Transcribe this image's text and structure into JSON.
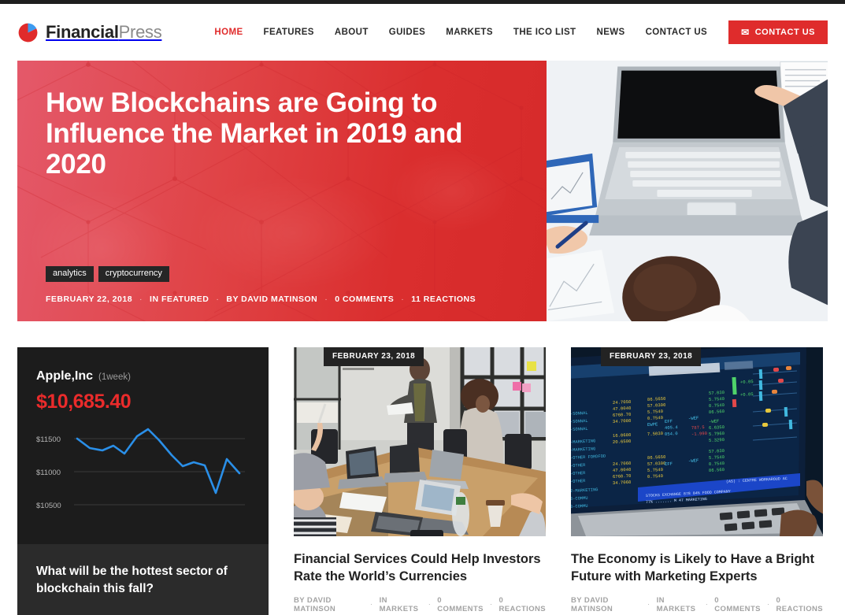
{
  "brand": {
    "name_bold": "Financial",
    "name_light": "Press",
    "logo_icon": "pie-chart-icon",
    "accent_red": "#df2c2c",
    "accent_blue": "#2a8fe8"
  },
  "nav": {
    "items": [
      {
        "label": "HOME",
        "active": true
      },
      {
        "label": "FEATURES",
        "active": false
      },
      {
        "label": "ABOUT",
        "active": false
      },
      {
        "label": "GUIDES",
        "active": false
      },
      {
        "label": "MARKETS",
        "active": false
      },
      {
        "label": "THE ICO LIST",
        "active": false
      },
      {
        "label": "NEWS",
        "active": false
      },
      {
        "label": "CONTACT US",
        "active": false
      }
    ],
    "cta": {
      "label": "CONTACT US",
      "icon": "envelope-icon"
    }
  },
  "hero": {
    "title": "How Blockchains are Going to Influence the Market in 2019 and 2020",
    "tags": [
      "analytics",
      "cryptocurrency"
    ],
    "meta": {
      "date": "FEBRUARY 22, 2018",
      "category": "IN FEATURED",
      "author": "BY DAVID MATINSON",
      "comments": "0 COMMENTS",
      "reactions": "11 REACTIONS",
      "separator": "·"
    },
    "image_alt": "businessman-pointing-at-laptop-on-white-desk"
  },
  "stock_widget": {
    "name": "Apple,Inc",
    "period": "(1week)",
    "price": "$10,685.40"
  },
  "chart_data": {
    "type": "line",
    "title": "Apple,Inc (1week)",
    "xlabel": "",
    "ylabel": "",
    "ylim": [
      10350,
      11750
    ],
    "ytick_labels": [
      "$11500",
      "$11000",
      "$10500"
    ],
    "ytick_values": [
      11500,
      11000,
      10500
    ],
    "grid": true,
    "legend": "none",
    "line_color": "#2a8fe8",
    "series": [
      {
        "name": "Apple,Inc",
        "x": [
          0,
          1,
          2,
          3,
          4,
          5,
          6,
          7,
          8,
          9,
          10,
          11,
          12,
          13,
          14,
          15
        ],
        "values": [
          11500,
          11360,
          11400,
          11290,
          11520,
          11690,
          11480,
          11230,
          11000,
          11070,
          11010,
          10560,
          11100,
          10800
        ]
      }
    ]
  },
  "poll": {
    "question": "What will be the hottest sector of blockchain this fall?"
  },
  "articles": [
    {
      "date": "FEBRUARY 23, 2018",
      "title": "Financial Services Could Help Investors Rate the World’s Currencies",
      "author": "BY DAVID MATINSON",
      "category": "IN MARKETS",
      "comments": "0 COMMENTS",
      "reactions": "0 REACTIONS",
      "separator": "·",
      "image_alt": "office-meeting-room-presentation"
    },
    {
      "date": "FEBRUARY 23, 2018",
      "title": "The Economy is Likely to Have a Bright Future with Marketing Experts",
      "author": "BY DAVID MATINSON",
      "category": "IN MARKETS",
      "comments": "0 COMMENTS",
      "reactions": "0 REACTIONS",
      "separator": "·",
      "image_alt": "stock-trading-terminal-screen"
    }
  ]
}
